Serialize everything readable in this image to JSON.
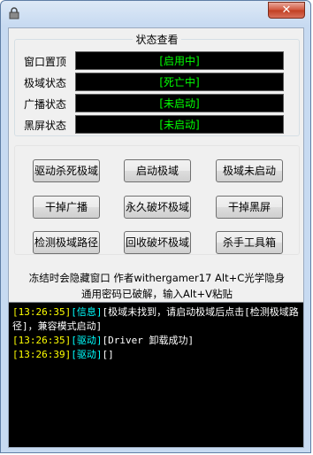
{
  "window": {
    "close_glyph": "✕"
  },
  "status_group": {
    "title": "状态查看",
    "rows": [
      {
        "label": "窗口置顶",
        "value": "[启用中]"
      },
      {
        "label": "极域状态",
        "value": "[死亡中]"
      },
      {
        "label": "广播状态",
        "value": "[未启动]"
      },
      {
        "label": "黑屏状态",
        "value": "[未启动]"
      }
    ]
  },
  "buttons": [
    {
      "label": "驱动杀死极域"
    },
    {
      "label": "启动极域"
    },
    {
      "label": "极域未启动"
    },
    {
      "label": "干掉广播"
    },
    {
      "label": "永久破坏极域"
    },
    {
      "label": "干掉黑屏"
    },
    {
      "label": "检测极域路径"
    },
    {
      "label": "回收破坏极域"
    },
    {
      "label": "杀手工具箱"
    }
  ],
  "notices": {
    "line1": "冻结时会隐藏窗口 作者withergamer17 Alt+C光学隐身",
    "line2": "通用密码已破解，输入Alt+V粘贴"
  },
  "log": [
    {
      "time": "[13:26:35]",
      "tag": "[信息]",
      "msg": "[极域未找到，请启动极域后点击[检测极域路径]，兼容模式启动]"
    },
    {
      "time": "[13:26:35]",
      "tag": "[驱动]",
      "msg": "[Driver 卸载成功]"
    },
    {
      "time": "[13:26:39]",
      "tag": "[驱动]",
      "msg": "[]"
    }
  ],
  "colors": {
    "status_text": "#00ff00",
    "log_time": "#ffff00",
    "log_tag": "#00ffff"
  }
}
